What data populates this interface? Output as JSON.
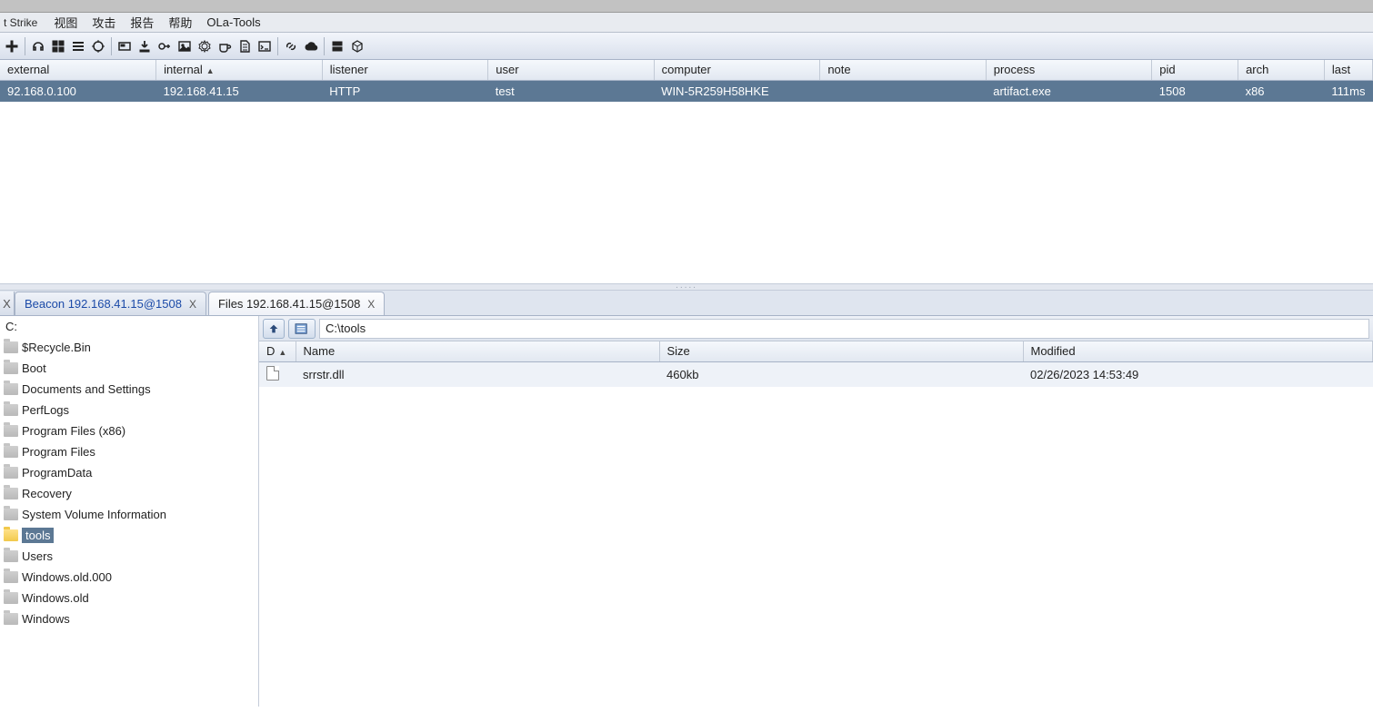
{
  "app_title_fragment": "t Strike",
  "menu": [
    "视图",
    "攻击",
    "报告",
    "帮助",
    "OLa-Tools"
  ],
  "toolbar_icons": [
    "plus-icon",
    "headset-icon",
    "grid-icon",
    "lines-icon",
    "target-icon",
    "sep",
    "card-icon",
    "download-icon",
    "key-icon",
    "image-icon",
    "gear-icon",
    "coffee-icon",
    "page-icon",
    "terminal-icon",
    "sep",
    "link-icon",
    "cloud-icon",
    "sep",
    "server-icon",
    "cube-icon"
  ],
  "beacon_columns": [
    "external",
    "internal",
    "listener",
    "user",
    "computer",
    "note",
    "process",
    "pid",
    "arch",
    "last"
  ],
  "beacon_sort_col": "internal",
  "beacons": [
    {
      "external": "92.168.0.100",
      "internal": "192.168.41.15",
      "listener": "HTTP",
      "user": "test",
      "computer": "WIN-5R259H58HKE",
      "note": "",
      "process": "artifact.exe",
      "pid": "1508",
      "arch": "x86",
      "last": "111ms"
    }
  ],
  "tabs": [
    {
      "label": "Beacon 192.168.41.15@1508",
      "active": false
    },
    {
      "label": "Files 192.168.41.15@1508",
      "active": true
    }
  ],
  "tab_close_glyph": "X",
  "dir_root": "C:",
  "dir_tree": [
    {
      "label": "$Recycle.Bin",
      "selected": false
    },
    {
      "label": "Boot",
      "selected": false
    },
    {
      "label": "Documents and Settings",
      "selected": false
    },
    {
      "label": "PerfLogs",
      "selected": false
    },
    {
      "label": "Program Files (x86)",
      "selected": false
    },
    {
      "label": "Program Files",
      "selected": false
    },
    {
      "label": "ProgramData",
      "selected": false
    },
    {
      "label": "Recovery",
      "selected": false
    },
    {
      "label": "System Volume Information",
      "selected": false
    },
    {
      "label": "tools",
      "selected": true
    },
    {
      "label": "Users",
      "selected": false
    },
    {
      "label": "Windows.old.000",
      "selected": false
    },
    {
      "label": "Windows.old",
      "selected": false
    },
    {
      "label": "Windows",
      "selected": false
    }
  ],
  "path_value": "C:\\tools",
  "file_columns": [
    "D",
    "Name",
    "Size",
    "Modified"
  ],
  "file_sort_col": "D",
  "files": [
    {
      "d": "file",
      "name": "srrstr.dll",
      "size": "460kb",
      "modified": "02/26/2023 14:53:49"
    }
  ]
}
